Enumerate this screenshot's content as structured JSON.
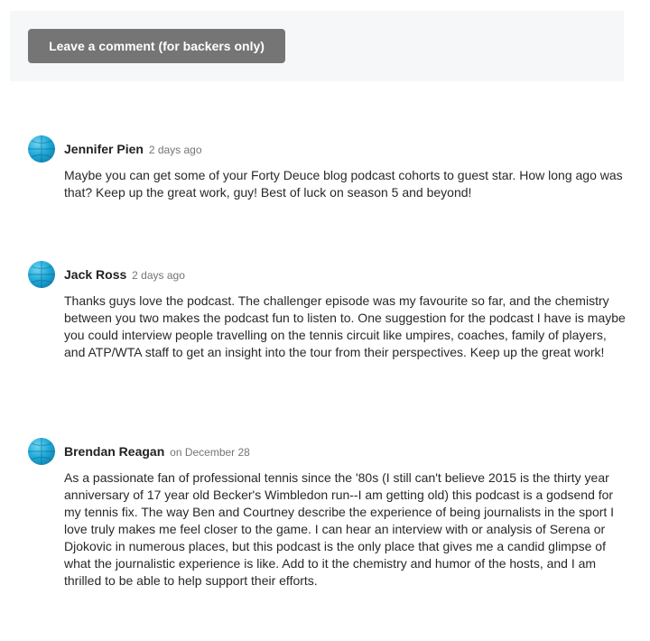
{
  "actions": {
    "comment_button_label": "Leave a comment (for backers only)"
  },
  "comments": [
    {
      "author": "Jennifer Pien",
      "time": "2 days ago",
      "body": "Maybe you can get some of your Forty Deuce blog podcast cohorts to guest star. How long ago was that? Keep up the great work, guy! Best of luck on season 5 and beyond!"
    },
    {
      "author": "Jack Ross",
      "time": "2 days ago",
      "body": "Thanks guys love the podcast. The challenger episode was my favourite so far, and the chemistry between you two makes the podcast fun to listen to. One suggestion for the podcast I have is maybe you could interview people travelling on the tennis circuit like umpires, coaches, family of players, and ATP/WTA staff to get an insight into the tour from their perspectives. Keep up the great work!"
    },
    {
      "author": "Brendan Reagan",
      "time": "on December 28",
      "body": "As a passionate fan of professional tennis since the '80s (I still can't believe 2015 is the thirty year anniversary of 17 year old Becker's Wimbledon run--I am getting old) this podcast is a godsend for my tennis fix. The way Ben and Courtney describe the experience of being journalists in the sport I love truly makes me feel closer to the game. I can hear an interview with or analysis of Serena or Djokovic in numerous places, but this podcast is the only place that gives me a candid glimpse of what the journalistic experience is like. Add to it the chemistry and humor of the hosts, and I am thrilled to be able to help support their efforts."
    }
  ],
  "colors": {
    "button_bg": "#757575",
    "bar_bg": "#f6f7f8",
    "avatar": "#1fa9d8"
  }
}
